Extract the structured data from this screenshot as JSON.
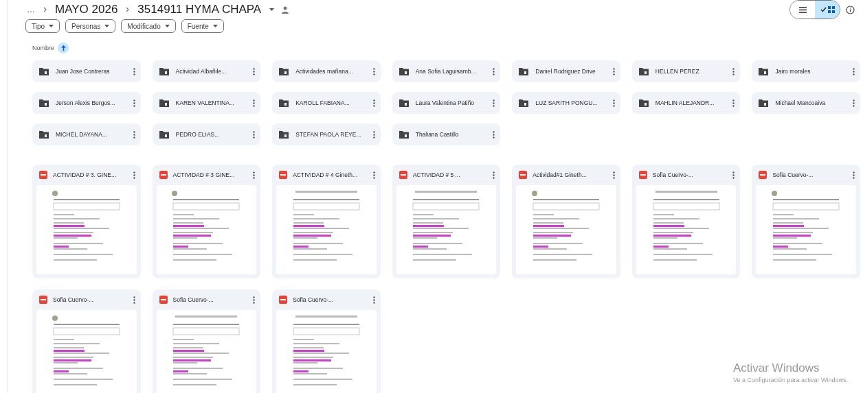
{
  "breadcrumb": {
    "more": "…",
    "items": [
      "MAYO 2026",
      "3514911 HYMA CHAPA"
    ]
  },
  "view_toggle": [
    {
      "kind": "list",
      "selected": false
    },
    {
      "kind": "grid",
      "selected": true
    }
  ],
  "filters": [
    "Tipo",
    "Personas",
    "Modificado",
    "Fuente"
  ],
  "sort": {
    "label": "Nombre"
  },
  "folders": [
    "Juan Jose Contreras",
    "Actividad Albañile...",
    "Actividades mañana...",
    "Ana Sofia Laguisamb...",
    "Daniel Rodriguez Drive",
    "HELLEN PEREZ",
    "Jairo morales",
    "Jerson Alexis Burgos...",
    "KAREN VALENTINA...",
    "KAROLL FABIANA...",
    "Laura Valentina Patiño",
    "LUZ SARITH PONGU...",
    "MAHLIN ALEJANDR...",
    "Michael Mancoaiva",
    "MICHEL DAYANA...",
    "PEDRO ELIAS...",
    "STEFAN PAOLA REYE...",
    "Thaliana Castillo"
  ],
  "files": [
    "ACTIVIDAD # 3. GINE...",
    "ACTIVIDAD # 3 GINE...",
    "ACTIVIDAD # 4 Gineth...",
    "ACTIVIDAD # 5 ...",
    "Actividad#1 Gineth...",
    "Sofia Cuervo-...",
    "Sofia Cuervo-...",
    "Sofia Cuervo-...",
    "Sofia Cuervo-...",
    "Sofia Cuervo-..."
  ],
  "windows_notice": {
    "title": "Activar Windows",
    "subtitle": "Ve a Configuración para activar Windows."
  }
}
